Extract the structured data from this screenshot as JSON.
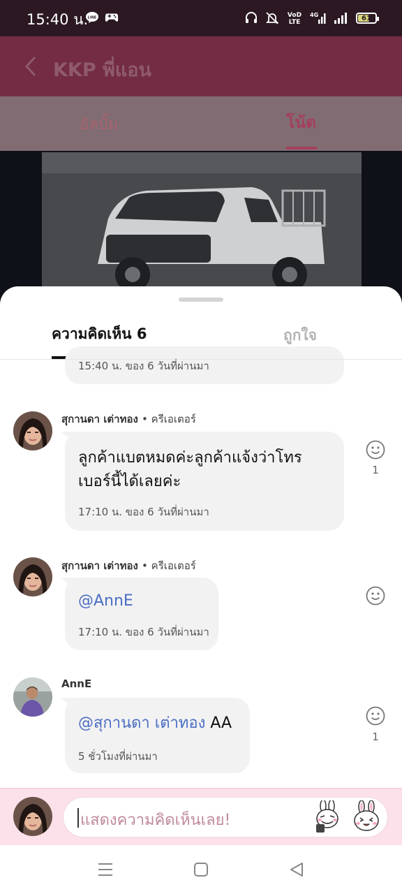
{
  "status_bar": {
    "time": "15:40 น.",
    "battery": "61",
    "network": "4G",
    "volte": "VoLTE"
  },
  "header": {
    "title": "KKP พี่แอน"
  },
  "tabs": {
    "album": "อัลบั้ม",
    "note": "โน้ต"
  },
  "sheet": {
    "tab_comments": "ความคิดเห็น 6",
    "tab_likes": "ถูกใจ",
    "previous_comment_meta": "15:40 น. ของ 6 วันที่ผ่านมา"
  },
  "comments": [
    {
      "author": "สุกานดา เต่าทอง",
      "role": "• ครีเอเตอร์",
      "line1": "ลูกค้าแบตหมดค่ะลูกค้าแจ้งว่าโทร",
      "line2": "เบอร์นี้ได้เลยค่ะ",
      "meta": "17:10 น. ของ 6 วันที่ผ่านมา",
      "reactions": "1"
    },
    {
      "author": "สุกานดา เต่าทอง",
      "role": "• ครีเอเตอร์",
      "mention": "@AnnE",
      "meta": "17:10 น. ของ 6 วันที่ผ่านมา"
    },
    {
      "author": "AnnE",
      "mention": "@สุกานดา เต่าทอง",
      "text": " AA",
      "meta": "5 ชั่วโมงที่ผ่านมา",
      "reactions": "1"
    }
  ],
  "composer": {
    "placeholder": "แสดงความคิดเห็นเลย!"
  },
  "colors": {
    "header": "#732c43",
    "mention": "#4b6dc4",
    "composer_bg": "#fce0ea"
  }
}
